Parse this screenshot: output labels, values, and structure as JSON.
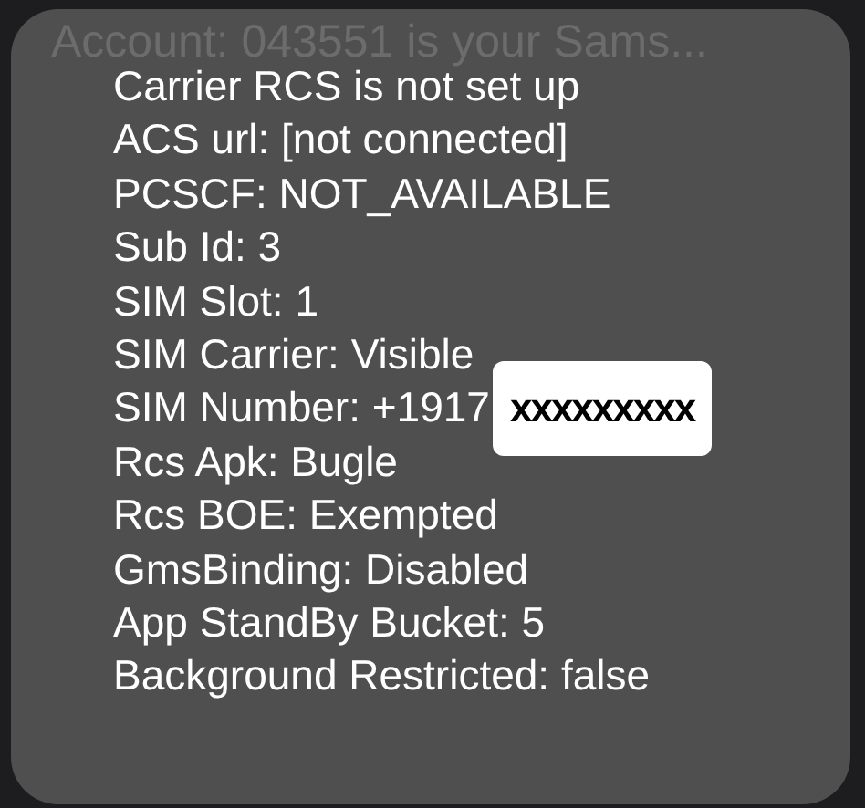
{
  "background_message": "Account: 043551 is your Sams...",
  "lines": [
    {
      "text": "Carrier RCS is not set up"
    },
    {
      "text": "ACS url: [not connected]"
    },
    {
      "text": "PCSCF: NOT_AVAILABLE"
    },
    {
      "text": "Sub Id: 3"
    },
    {
      "text": "SIM Slot: 1"
    },
    {
      "text": "SIM Carrier: Visible"
    },
    {
      "text": "SIM Number: +1917",
      "redaction": "xxxxxxxxx"
    },
    {
      "text": "Rcs Apk: Bugle"
    },
    {
      "text": "Rcs BOE: Exempted"
    },
    {
      "text": "GmsBinding: Disabled"
    },
    {
      "text": "App StandBy Bucket: 5"
    },
    {
      "text": "Background Restricted: false"
    }
  ]
}
